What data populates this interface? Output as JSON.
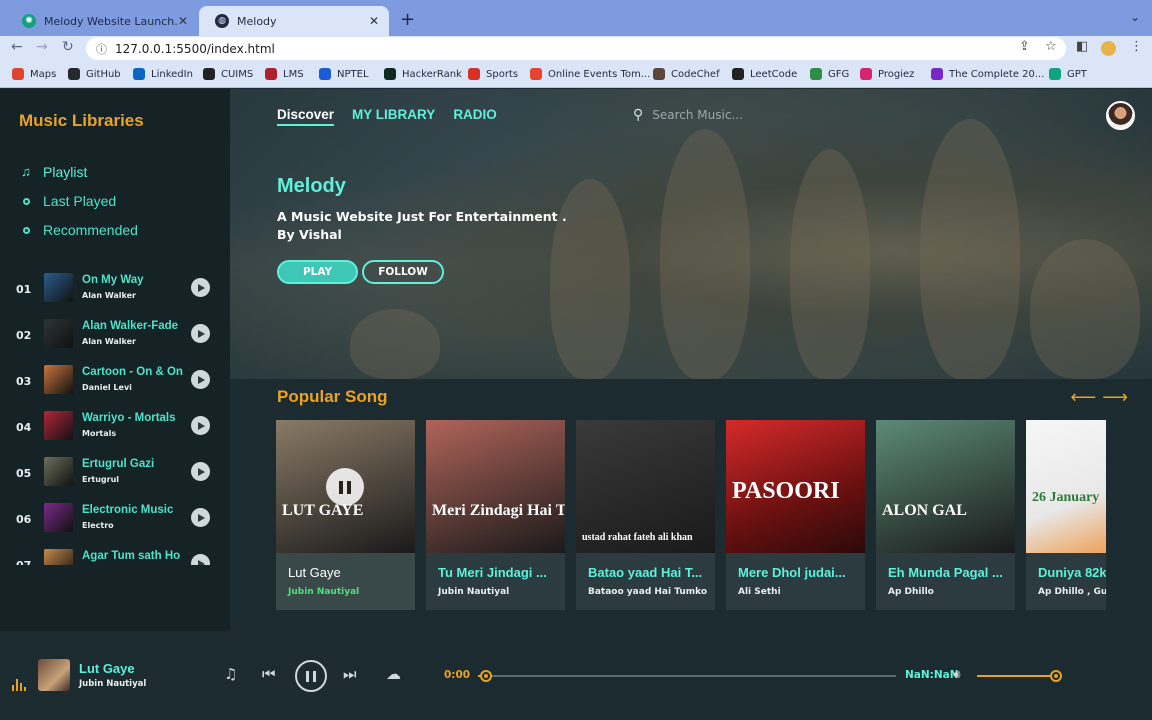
{
  "browser": {
    "tabs": [
      {
        "label": "Melody Website Launch.",
        "icon": "chatgpt-icon"
      },
      {
        "label": "Melody",
        "icon": "globe-icon"
      }
    ],
    "url": "127.0.0.1:5500/index.html",
    "bookmarks": [
      {
        "label": "Maps",
        "color": "#e0442e"
      },
      {
        "label": "GitHub",
        "color": "#24292e"
      },
      {
        "label": "LinkedIn",
        "color": "#0a66c2"
      },
      {
        "label": "CUIMS",
        "color": "#222222"
      },
      {
        "label": "LMS",
        "color": "#b1212b"
      },
      {
        "label": "NPTEL",
        "color": "#1c5bd8"
      },
      {
        "label": "HackerRank",
        "color": "#0f2a20"
      },
      {
        "label": "Sports",
        "color": "#d93025"
      },
      {
        "label": "Online Events Tom...",
        "color": "#e8432e"
      },
      {
        "label": "CodeChef",
        "color": "#5b4638"
      },
      {
        "label": "LeetCode",
        "color": "#222222"
      },
      {
        "label": "GFG",
        "color": "#2f8d46"
      },
      {
        "label": "Progiez",
        "color": "#d6246e"
      },
      {
        "label": "The Complete 20...",
        "color": "#7a28c7"
      },
      {
        "label": "GPT",
        "color": "#10a37f"
      }
    ]
  },
  "sidebar": {
    "brand": "Music Libraries",
    "menu": [
      {
        "label": "Playlist",
        "icon": "music-note-icon",
        "active": true
      },
      {
        "label": "Last Played",
        "icon": "circle-icon",
        "active": false
      },
      {
        "label": "Recommended",
        "icon": "circle-icon",
        "active": false
      }
    ],
    "songs": [
      {
        "num": "01",
        "title": "On My Way",
        "artist": "Alan Walker",
        "color": "#2a5d8c"
      },
      {
        "num": "02",
        "title": "Alan Walker-Fade",
        "artist": "Alan Walker",
        "color": "#2c3538"
      },
      {
        "num": "03",
        "title": "Cartoon - On & On",
        "artist": "Daniel Levi",
        "color": "#c9743a"
      },
      {
        "num": "04",
        "title": "Warriyo - Mortals",
        "artist": "Mortals",
        "color": "#b2273a"
      },
      {
        "num": "05",
        "title": "Ertugrul Gazi",
        "artist": "Ertugrul",
        "color": "#6b6f5a"
      },
      {
        "num": "06",
        "title": "Electronic Music",
        "artist": "Electro",
        "color": "#7b2a8a"
      },
      {
        "num": "07",
        "title": "Agar Tum sath Ho",
        "artist": "",
        "color": "#c88a4a"
      }
    ]
  },
  "main": {
    "nav": [
      "Discover",
      "MY LIBRARY",
      "RADIO"
    ],
    "search_placeholder": "Search Music...",
    "hero": {
      "title": "Melody",
      "subtitle": "A Music Website Just For Entertainment . By Vishal",
      "play_label": "PLAY",
      "follow_label": "FOLLOW"
    },
    "popular_title": "Popular Song",
    "cards": [
      {
        "title": "Lut Gaye",
        "artist": "Jubin Nautiyal",
        "active": true,
        "bg": "#8a7a66",
        "art_text": "LUT GAYE"
      },
      {
        "title": "Tu Meri Jindagi ...",
        "artist": "Jubin Nautiyal",
        "active": false,
        "bg": "#b0645a",
        "art_text": "Meri Zindagi Hai Tu"
      },
      {
        "title": "Batao yaad Hai T...",
        "artist": "Bataoo yaad Hai Tumko",
        "active": false,
        "bg": "#3a3a3a",
        "art_text": "ustad rahat fateh ali khan"
      },
      {
        "title": "Mere Dhol judai...",
        "artist": "Ali Sethi",
        "active": false,
        "bg": "#a8282a",
        "art_text": "PASOORI"
      },
      {
        "title": "Eh Munda Pagal ...",
        "artist": "Ap Dhillo",
        "active": false,
        "bg": "#5c8a78",
        "art_text": "ALON GAL"
      },
      {
        "title": "Duniya 82k",
        "artist": "Ap Dhillo , Guri",
        "active": false,
        "bg": "#f0f0f0",
        "art_text": "26 January"
      }
    ]
  },
  "player": {
    "title": "Lut Gaye",
    "artist": "Jubin Nautiyal",
    "current_time": "0:00",
    "end_time": "NaN:NaN",
    "progress": 0.02,
    "volume": 1.0
  }
}
